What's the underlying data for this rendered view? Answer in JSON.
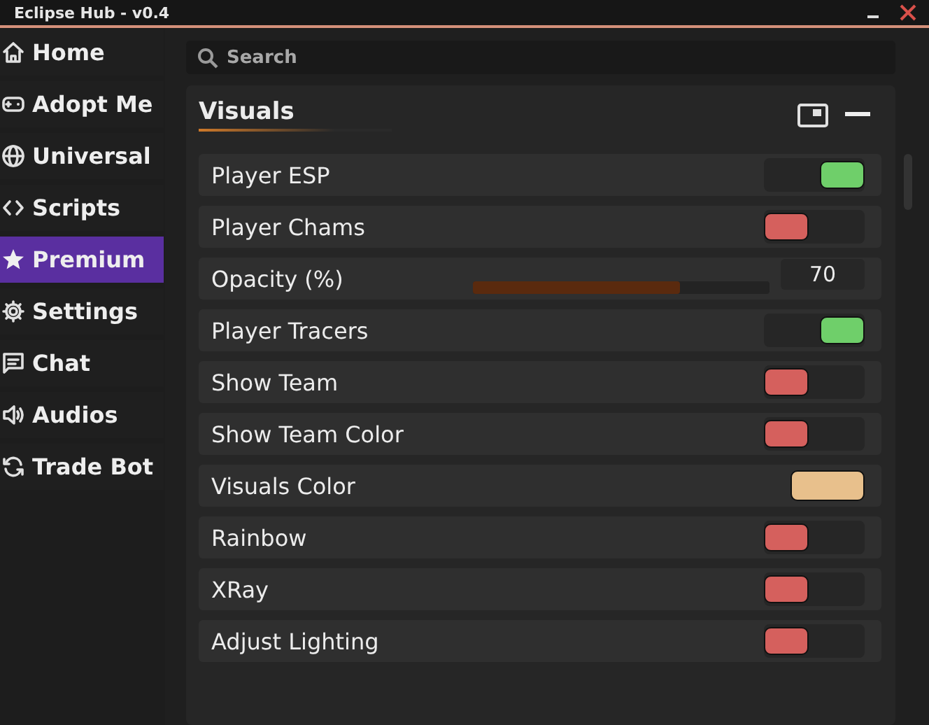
{
  "window": {
    "title": "Eclipse Hub - v0.4"
  },
  "sidebar": {
    "items": [
      {
        "label": "Home",
        "kind": "home",
        "selected": false
      },
      {
        "label": "Adopt Me",
        "kind": "gamepad",
        "selected": false
      },
      {
        "label": "Universal",
        "kind": "globe",
        "selected": false
      },
      {
        "label": "Scripts",
        "kind": "code",
        "selected": false
      },
      {
        "label": "Premium",
        "kind": "star",
        "selected": true
      },
      {
        "label": "Settings",
        "kind": "gear",
        "selected": false
      },
      {
        "label": "Chat",
        "kind": "chat",
        "selected": false
      },
      {
        "label": "Audios",
        "kind": "speaker",
        "selected": false
      },
      {
        "label": "Trade Bot",
        "kind": "sync",
        "selected": false
      }
    ]
  },
  "search": {
    "placeholder": "Search"
  },
  "section": {
    "title": "Visuals",
    "rows": [
      {
        "kind": "toggle",
        "label": "Player ESP",
        "on": true
      },
      {
        "kind": "toggle",
        "label": "Player Chams",
        "on": false
      },
      {
        "kind": "slider",
        "label": "Opacity (%)",
        "level": 0.7,
        "value": "70"
      },
      {
        "kind": "toggle",
        "label": "Player Tracers",
        "on": true
      },
      {
        "kind": "toggle",
        "label": "Show Team",
        "on": false
      },
      {
        "kind": "toggle",
        "label": "Show Team Color",
        "on": false
      },
      {
        "kind": "color",
        "label": "Visuals Color",
        "color": "#e8c08c"
      },
      {
        "kind": "toggle",
        "label": "Rainbow",
        "on": false
      },
      {
        "kind": "toggle",
        "label": "XRay",
        "on": false
      },
      {
        "kind": "toggle",
        "label": "Adjust Lighting",
        "on": false
      }
    ]
  }
}
